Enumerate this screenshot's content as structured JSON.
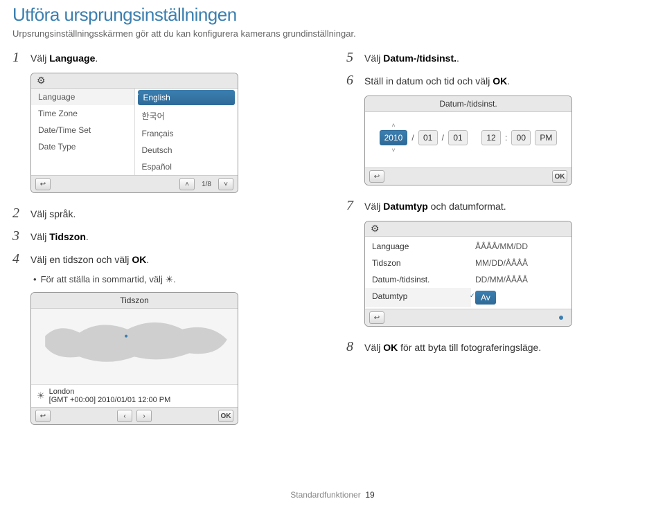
{
  "title": "Utföra ursprungsinställningen",
  "subtitle": "Urpsrungsinställningsskärmen gör att du kan konfigurera kamerans grundinställningar.",
  "steps": {
    "s1": {
      "num": "1",
      "pre": "Välj ",
      "bold": "Language",
      "post": "."
    },
    "s2": {
      "num": "2",
      "text": "Välj språk."
    },
    "s3": {
      "num": "3",
      "pre": "Välj ",
      "bold": "Tidszon",
      "post": "."
    },
    "s4": {
      "num": "4",
      "pre": "Välj en tidszon och välj ",
      "ok": "OK",
      "post": "."
    },
    "s4b": {
      "pre": "För att ställa in sommartid, välj ",
      "icon": "☀",
      "post": "."
    },
    "s5": {
      "num": "5",
      "pre": "Välj ",
      "bold": "Datum-/tidsinst.",
      "post": "."
    },
    "s6": {
      "num": "6",
      "pre": "Ställ in datum och tid och välj ",
      "ok": "OK",
      "post": "."
    },
    "s7": {
      "num": "7",
      "pre": "Välj ",
      "bold": "Datumtyp",
      "post": " och datumformat."
    },
    "s8": {
      "num": "8",
      "pre": "Välj ",
      "ok": "OK",
      "post": " för att byta till fotograferingsläge."
    }
  },
  "langPanel": {
    "left": [
      "Language",
      "Time Zone",
      "Date/Time Set",
      "Date Type"
    ],
    "rightSel": "English",
    "right": [
      "한국어",
      "Français",
      "Deutsch",
      "Español"
    ],
    "page": "1/8"
  },
  "tzPanel": {
    "title": "Tidszon",
    "loc": "London",
    "stamp": "[GMT +00:00] 2010/01/01 12:00 PM"
  },
  "dtPanel": {
    "title": "Datum-/tidsinst.",
    "year": "2010",
    "mon": "01",
    "day": "01",
    "hour": "12",
    "min": "00",
    "ampm": "PM"
  },
  "fmtPanel": {
    "rows": [
      {
        "l": "Language",
        "r": "ÅÅÅÅ/MM/DD"
      },
      {
        "l": "Tidszon",
        "r": "MM/DD/ÅÅÅÅ"
      },
      {
        "l": "Datum-/tidsinst.",
        "r": "DD/MM/ÅÅÅÅ"
      }
    ],
    "lastL": "Datumtyp",
    "lastR": "Av"
  },
  "footer": {
    "label": "Standardfunktioner",
    "page": "19"
  },
  "ok": "OK"
}
